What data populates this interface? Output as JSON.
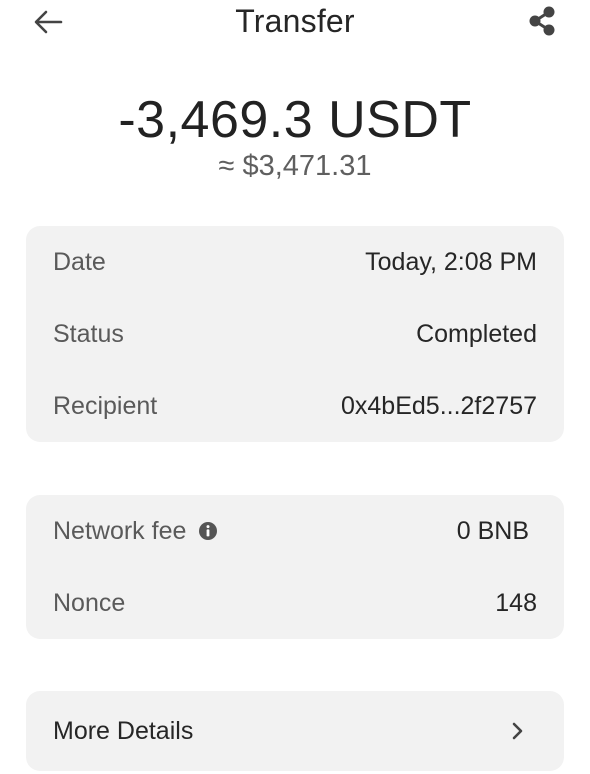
{
  "header": {
    "title": "Transfer",
    "back_icon": "arrow-left-icon",
    "share_icon": "share-icon"
  },
  "summary": {
    "amount": "-3,469.3 USDT",
    "fiat_value": "≈ $3,471.31"
  },
  "details": {
    "date_label": "Date",
    "date_value": "Today, 2:08 PM",
    "status_label": "Status",
    "status_value": "Completed",
    "recipient_label": "Recipient",
    "recipient_value": "0x4bEd5...2f2757"
  },
  "fees": {
    "network_fee_label": "Network fee",
    "network_fee_value": "0 BNB",
    "info_icon": "info-icon",
    "nonce_label": "Nonce",
    "nonce_value": "148"
  },
  "more": {
    "label": "More Details",
    "chevron_icon": "chevron-right-icon"
  },
  "colors": {
    "background": "#ffffff",
    "card_background": "#f2f2f2",
    "primary_text": "#262626",
    "secondary_text": "#5a5a5a"
  }
}
